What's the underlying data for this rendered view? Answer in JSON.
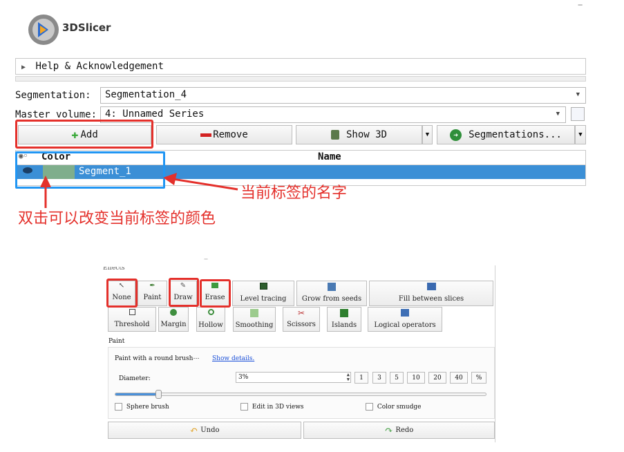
{
  "app": {
    "name": "3DSlicer"
  },
  "help": {
    "label": "Help & Acknowledgement"
  },
  "segmentation": {
    "label": "Segmentation:",
    "value": "Segmentation_4"
  },
  "master_volume": {
    "label": "Master volume:",
    "value": "4: Unnamed Series"
  },
  "toolbar": {
    "add": "Add",
    "remove": "Remove",
    "show3d": "Show 3D",
    "segmentations": "Segmentations..."
  },
  "table": {
    "headers": {
      "color": "Color",
      "name": "Name"
    },
    "rows": [
      {
        "name": "Segment_1",
        "color": "#7fae8c"
      }
    ]
  },
  "annotations": {
    "name_note": "当前标签的名字",
    "color_note": "双击可以改变当前标签的颜色"
  },
  "effects": {
    "section_label": "Effects",
    "row1": [
      "None",
      "Paint",
      "Draw",
      "Erase",
      "Level tracing",
      "Grow from seeds",
      "Fill between slices"
    ],
    "row2": [
      "Threshold",
      "Margin",
      "Hollow",
      "Smoothing",
      "Scissors",
      "Islands",
      "Logical operators"
    ]
  },
  "paint": {
    "title": "Paint",
    "description": "Paint with a round brush⋯",
    "details_link": "Show details.",
    "diameter_label": "Diameter:",
    "diameter_value": "3%",
    "presets": [
      "1",
      "3",
      "5",
      "10",
      "20",
      "40",
      "%"
    ],
    "slider_fraction": 0.11,
    "options": {
      "sphere": "Sphere brush",
      "edit3d": "Edit in 3D views",
      "smudge": "Color smudge"
    }
  },
  "history": {
    "undo": "Undo",
    "redo": "Redo"
  },
  "colors": {
    "selection": "#3b8fd6",
    "accent_red": "#e4302b",
    "accent_blue": "#2196f3",
    "segment": "#7fae8c"
  }
}
